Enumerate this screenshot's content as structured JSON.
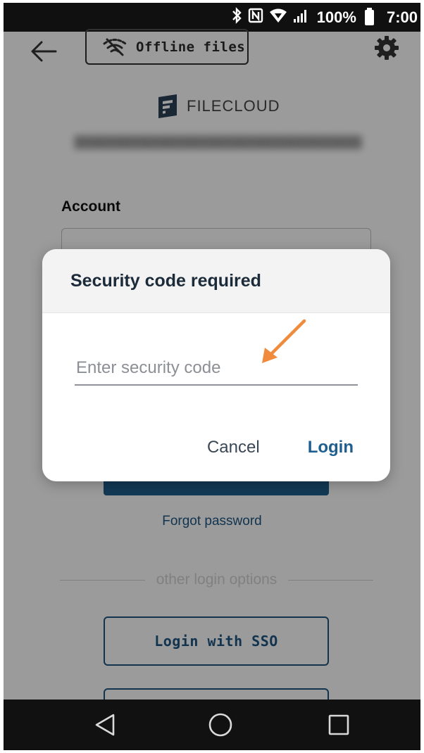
{
  "status_bar": {
    "battery_percent": "100%",
    "time": "7:00",
    "icons": [
      "bluetooth-icon",
      "nfc-icon",
      "wifi-icon",
      "signal-icon",
      "battery-icon"
    ]
  },
  "header": {
    "back_icon": "arrow-left-icon",
    "offline_files_label": "Offline files",
    "offline_icon": "wifi-off-icon",
    "settings_icon": "gear-icon"
  },
  "brand": {
    "name": "FILECLOUD"
  },
  "login_form": {
    "account_label": "Account",
    "forgot_password": "Forgot password",
    "other_options": "other login options",
    "sso_label": "Login with SSO"
  },
  "dialog": {
    "title": "Security code required",
    "input_placeholder": "Enter security code",
    "input_value": "",
    "cancel_label": "Cancel",
    "login_label": "Login"
  },
  "colors": {
    "accent": "#1e5f8f",
    "annotation_arrow": "#f08a3c"
  },
  "nav_bar": {
    "icons": [
      "back-triangle-icon",
      "home-circle-icon",
      "recents-square-icon"
    ]
  }
}
